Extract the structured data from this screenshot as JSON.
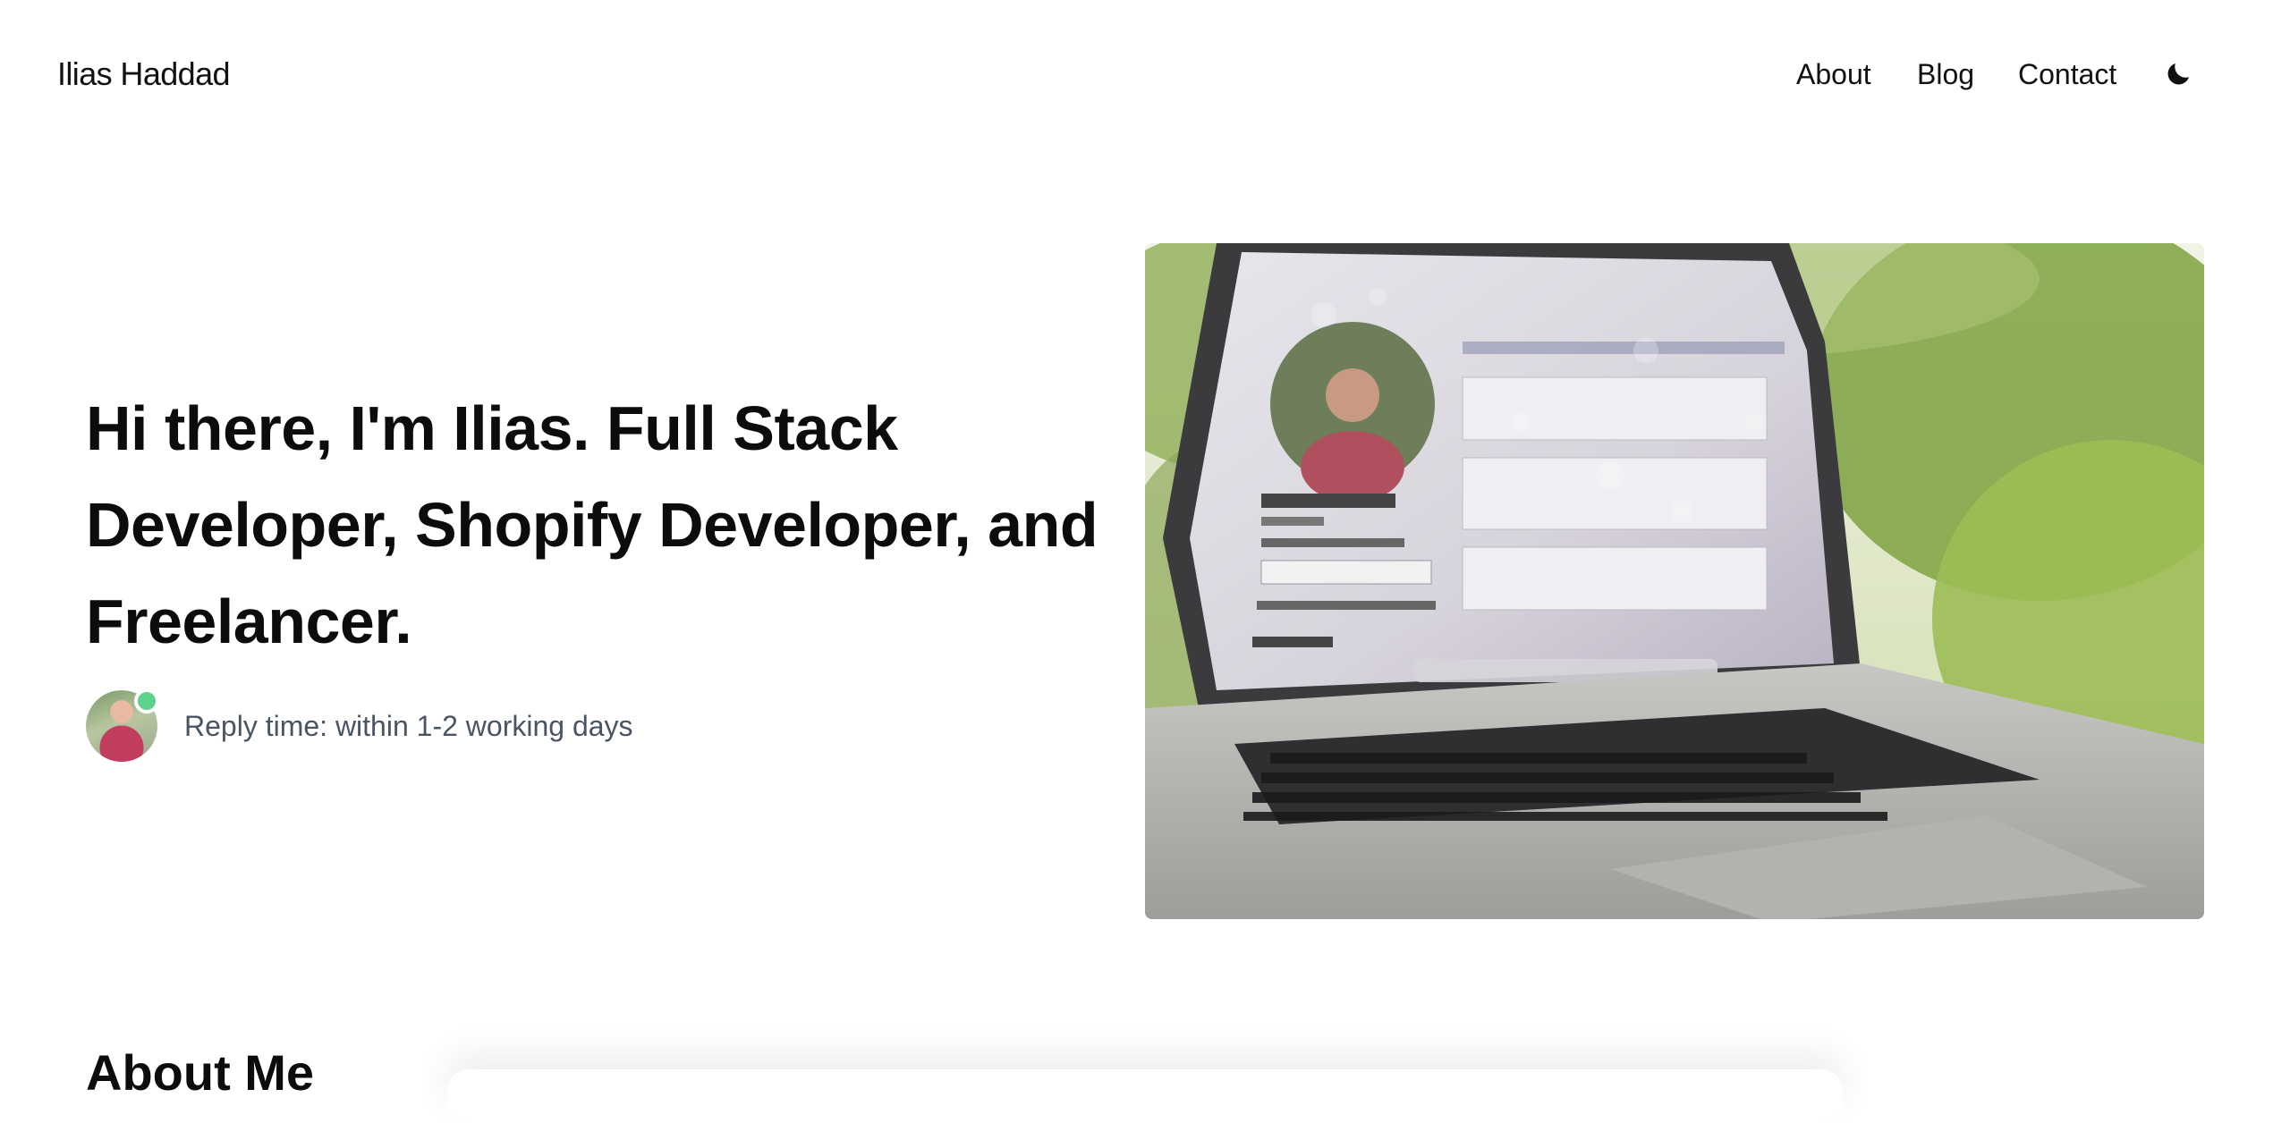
{
  "header": {
    "brand": "Ilias Haddad",
    "nav": [
      {
        "label": "About"
      },
      {
        "label": "Blog"
      },
      {
        "label": "Contact"
      }
    ],
    "theme_toggle_icon": "moon-icon"
  },
  "hero": {
    "headline": "Hi there, I'm Ilias. Full Stack Developer, Shopify Developer, and Freelancer.",
    "reply_time": "Reply time: within 1-2 working days",
    "status_color": "#5ed28c",
    "avatar_icon": "profile-photo",
    "photo_icon": "laptop-photo"
  },
  "about": {
    "title": "About Me"
  }
}
